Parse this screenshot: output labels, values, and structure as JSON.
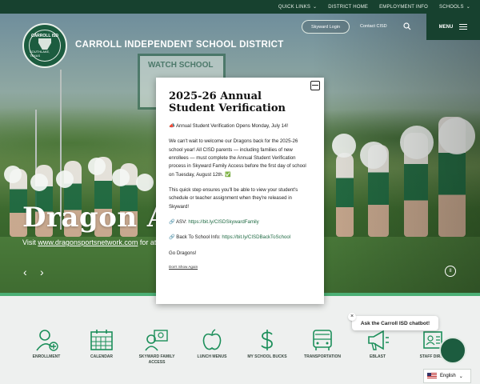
{
  "topbar": {
    "links": [
      {
        "label": "QUICK LINKS",
        "chevron": true
      },
      {
        "label": "DISTRICT HOME",
        "chevron": false
      },
      {
        "label": "EMPLOYMENT INFO",
        "chevron": false
      },
      {
        "label": "SCHOOLS",
        "chevron": true
      }
    ]
  },
  "header": {
    "district_name": "CARROLL INDEPENDENT SCHOOL DISTRICT",
    "logo_top": "CARROLL ISD",
    "logo_bottom": "SOUTHLAKE, TEXAS",
    "skyward_label": "Skyward Login",
    "contact_label": "Contact CISD",
    "menu_label": "MENU"
  },
  "hero": {
    "sign_text": "WATCH SCHOOL",
    "slide_title": "Dragon At",
    "slide_sub_prefix": "Visit ",
    "slide_sub_link": "www.dragonsportsnetwork.com",
    "slide_sub_suffix": " for ath"
  },
  "modal": {
    "title": "2025-26 Annual Student Verification",
    "p1": "📣 Annual Student Verification Opens Monday, July 14!",
    "p2": "We can't wait to welcome our Dragons back for the 2025-26 school year! All CISD parents — including families of new enrollees — must complete the Annual Student Verification process in Skyward Family Access before the first day of school on Tuesday, August 12th. ✅",
    "p3": "This quick step ensures you'll be able to view your student's schedule or teacher assignment when they're released in Skyward!",
    "asv_label": "🔗 ASV: ",
    "asv_link": "https://bit.ly/CISDSkywardFamily",
    "bts_label": "🔗 Back To School Info: ",
    "bts_link": "https://bit.ly/CISDBackToSchool",
    "p6": "Go Dragons!",
    "dont_show": "Don't Show Again"
  },
  "quicklinks": [
    {
      "label": "ENROLLMENT",
      "icon": "enrollment-icon"
    },
    {
      "label": "CALENDAR",
      "icon": "calendar-icon"
    },
    {
      "label": "SKYWARD FAMILY ACCESS",
      "icon": "skyward-icon"
    },
    {
      "label": "LUNCH MENUS",
      "icon": "apple-icon"
    },
    {
      "label": "MY SCHOOL BUCKS",
      "icon": "dollar-icon"
    },
    {
      "label": "TRANSPORTATION",
      "icon": "bus-icon"
    },
    {
      "label": "EBLAST",
      "icon": "megaphone-icon"
    },
    {
      "label": "STAFF DIREC",
      "icon": "staff-icon"
    }
  ],
  "chat": {
    "label": "Ask the Carroll ISD chatbot!",
    "close": "×"
  },
  "language": {
    "label": "English"
  },
  "colors": {
    "brand_dark": "#17412f",
    "brand_green": "#1c5c3f",
    "accent": "#4caf75"
  }
}
